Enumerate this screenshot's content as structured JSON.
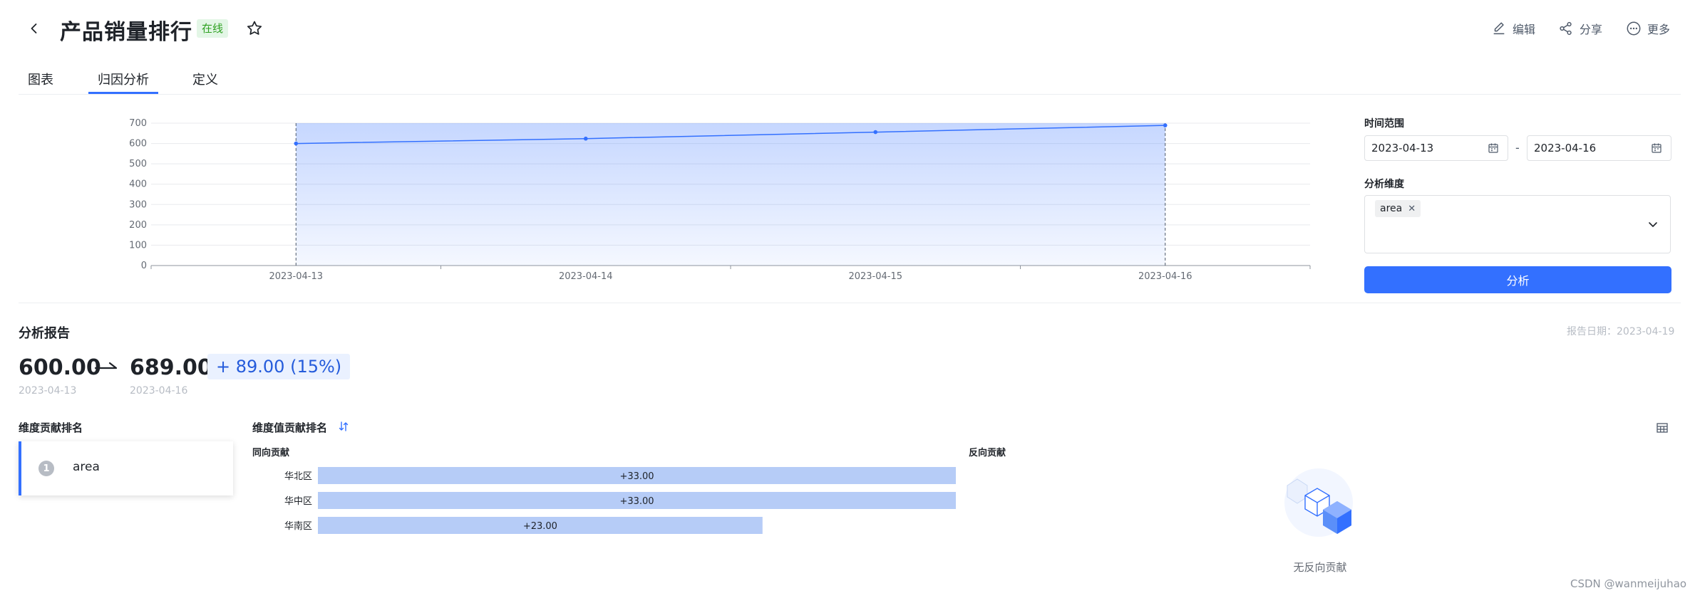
{
  "header": {
    "title": "产品销量排行",
    "status": "在线",
    "actions": {
      "edit": "编辑",
      "share": "分享",
      "more": "更多"
    }
  },
  "tabs": [
    {
      "label": "图表"
    },
    {
      "label": "归因分析",
      "active": true
    },
    {
      "label": "定义"
    }
  ],
  "chart_data": {
    "type": "area",
    "categories": [
      "2023-04-13",
      "2023-04-14",
      "2023-04-15",
      "2023-04-16"
    ],
    "series": [
      {
        "values": [
          600,
          624,
          656,
          689
        ]
      }
    ],
    "ylim": [
      0,
      700
    ],
    "yticks": [
      0,
      100,
      200,
      300,
      400,
      500,
      600,
      700
    ],
    "grid": true,
    "color": "#3370ff"
  },
  "filters": {
    "time_label": "时间范围",
    "start_date": "2023-04-13",
    "separator": "-",
    "end_date": "2023-04-16",
    "dimension_label": "分析维度",
    "dimension_tags": [
      "area"
    ],
    "analyze_button": "分析"
  },
  "report": {
    "title": "分析报告",
    "date": "报告日期：2023-04-19",
    "start_value": "600.00",
    "end_value": "689.00",
    "delta": "+ 89.00 (15%)",
    "start_date": "2023-04-13",
    "end_date": "2023-04-16"
  },
  "dimension_ranking": {
    "title": "维度贡献排名",
    "items": [
      {
        "rank": "1",
        "name": "area"
      }
    ]
  },
  "value_ranking": {
    "title": "维度值贡献排名",
    "positive_label": "同向贡献",
    "negative_label": "反向贡献",
    "bars": [
      {
        "label": "华北区",
        "value": 33,
        "text": "+33.00"
      },
      {
        "label": "华中区",
        "value": 33,
        "text": "+33.00"
      },
      {
        "label": "华南区",
        "value": 23,
        "text": "+23.00"
      }
    ],
    "bar_color": "#b6ccf7",
    "empty_text": "无反向贡献"
  },
  "watermark": "CSDN @wanmeijuhao"
}
